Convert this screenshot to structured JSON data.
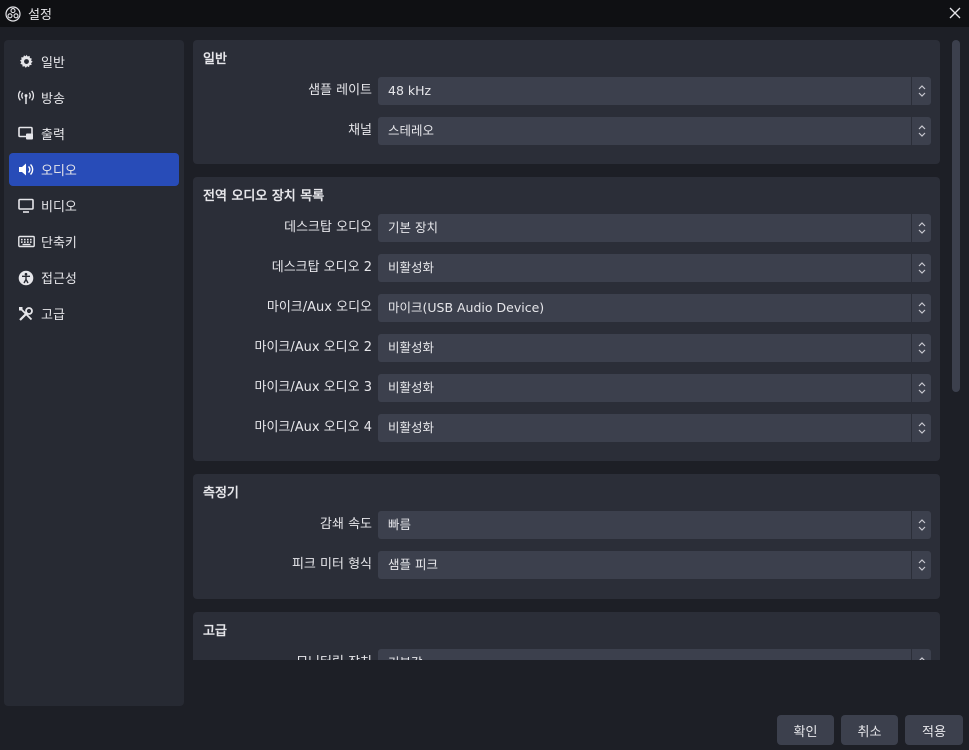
{
  "window": {
    "title": "설정",
    "app_icon": "obs-icon",
    "close_icon": "close-icon"
  },
  "sidebar": {
    "items": [
      {
        "label": "일반",
        "icon": "gear-icon",
        "active": false
      },
      {
        "label": "방송",
        "icon": "antenna-icon",
        "active": false
      },
      {
        "label": "출력",
        "icon": "output-icon",
        "active": false
      },
      {
        "label": "오디오",
        "icon": "speaker-icon",
        "active": true
      },
      {
        "label": "비디오",
        "icon": "monitor-icon",
        "active": false
      },
      {
        "label": "단축키",
        "icon": "keyboard-icon",
        "active": false
      },
      {
        "label": "접근성",
        "icon": "accessibility-icon",
        "active": false
      },
      {
        "label": "고급",
        "icon": "tools-icon",
        "active": false
      }
    ]
  },
  "groups": {
    "general": {
      "title": "일반",
      "rows": [
        {
          "label": "샘플 레이트",
          "value": "48 kHz"
        },
        {
          "label": "채널",
          "value": "스테레오"
        }
      ]
    },
    "devices": {
      "title": "전역 오디오 장치 목록",
      "rows": [
        {
          "label": "데스크탑 오디오",
          "value": "기본 장치"
        },
        {
          "label": "데스크탑 오디오 2",
          "value": "비활성화"
        },
        {
          "label": "마이크/Aux 오디오",
          "value": "마이크(USB Audio Device)"
        },
        {
          "label": "마이크/Aux 오디오 2",
          "value": "비활성화"
        },
        {
          "label": "마이크/Aux 오디오 3",
          "value": "비활성화"
        },
        {
          "label": "마이크/Aux 오디오 4",
          "value": "비활성화"
        }
      ]
    },
    "meters": {
      "title": "측정기",
      "rows": [
        {
          "label": "감쇄 속도",
          "value": "빠름"
        },
        {
          "label": "피크 미터 형식",
          "value": "샘플 피크"
        }
      ]
    },
    "advanced": {
      "title": "고급",
      "rows": [
        {
          "label": "모니터링 장치",
          "value": "기본값"
        }
      ]
    }
  },
  "buttons": {
    "ok": "확인",
    "cancel": "취소",
    "apply": "적용"
  },
  "colors": {
    "accent": "#284cb8",
    "panel": "#2b2e38",
    "field": "#3c404d"
  }
}
